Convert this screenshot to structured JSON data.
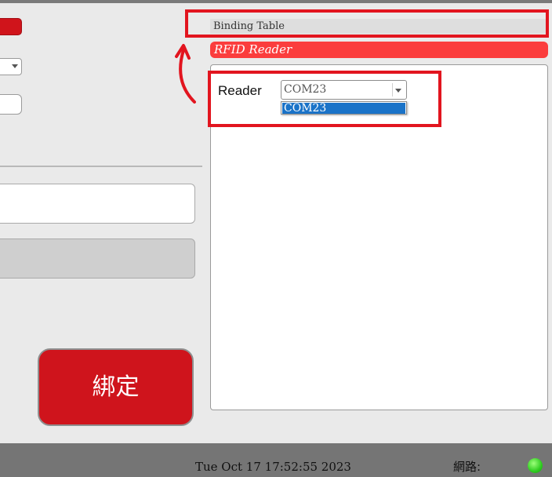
{
  "binding_table": {
    "title": "Binding Table"
  },
  "rfid_section": {
    "title": "RFID Reader",
    "reader_label": "Reader",
    "reader_selected": "COM23",
    "reader_options": [
      "COM23"
    ]
  },
  "left_panel": {
    "bind_button_label": "綁定"
  },
  "status_bar": {
    "datetime": "Tue Oct 17 17:52:55 2023",
    "network_label": "網路:",
    "network_status_color": "#2ecc1f"
  },
  "colors": {
    "accent_red": "#cf141c",
    "highlight_red": "#e2151f",
    "section_red": "#fb3d3d",
    "selection_blue": "#1a73c8"
  }
}
